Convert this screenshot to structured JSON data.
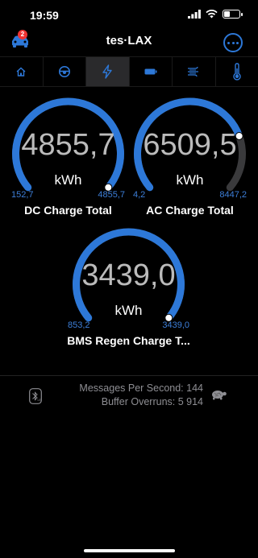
{
  "status_bar": {
    "time": "19:59"
  },
  "header": {
    "title": "tes·LAX",
    "notification_count": "2"
  },
  "tabs": [
    {
      "icon": "home-icon"
    },
    {
      "icon": "steering-wheel-icon"
    },
    {
      "icon": "lightning-icon",
      "active": true
    },
    {
      "icon": "battery-icon"
    },
    {
      "icon": "climate-icon"
    },
    {
      "icon": "thermometer-icon"
    }
  ],
  "gauges": [
    {
      "value": "4855,7",
      "unit": "kWh",
      "min": "152,7",
      "max": "4855,7",
      "label": "DC Charge Total",
      "level": 1.0
    },
    {
      "value": "6509,5",
      "unit": "kWh",
      "min": "4,2",
      "max": "8447,2",
      "label": "AC Charge Total",
      "level": 0.77
    },
    {
      "value": "3439,0",
      "unit": "kWh",
      "min": "853,2",
      "max": "3439,0",
      "label": "BMS Regen Charge T...",
      "level": 1.0
    }
  ],
  "stats": {
    "messages_label": "Messages Per Second: 144",
    "overruns_label": "Buffer Overruns:  5 914"
  },
  "colors": {
    "accent": "#2d78d8",
    "gauge_track": "#3a3a3c"
  }
}
